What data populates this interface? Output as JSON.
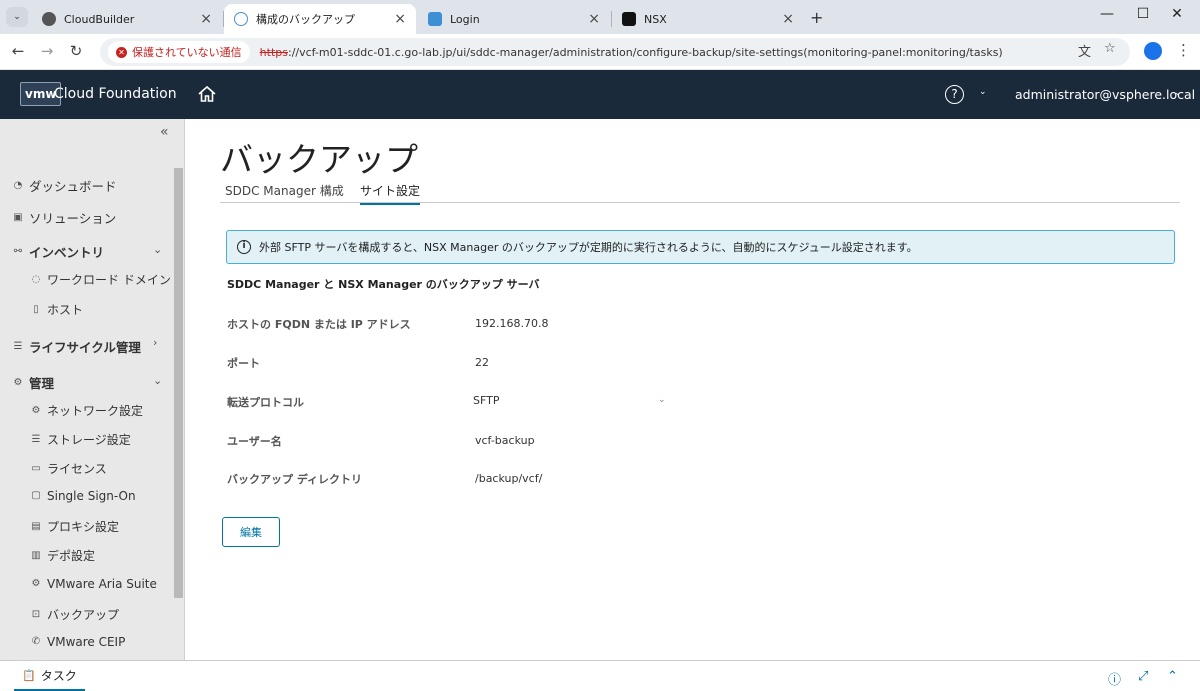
{
  "browser": {
    "tabs": [
      {
        "title": "CloudBuilder",
        "icon": "globe-icon"
      },
      {
        "title": "構成のバックアップ",
        "icon": "cloud-icon",
        "active": true
      },
      {
        "title": "Login",
        "icon": "app-icon"
      },
      {
        "title": "NSX",
        "icon": "nsx-icon"
      }
    ],
    "security_chip": "保護されていない通信",
    "url_scheme": "https",
    "url_rest": "://vcf-m01-sddc-01.c.go-lab.jp/ui/sddc-manager/administration/configure-backup/site-settings(monitoring-panel:monitoring/tasks)"
  },
  "header": {
    "logo": "vmw",
    "brand": "Cloud Foundation",
    "user": "administrator@vsphere.local"
  },
  "sidebar": {
    "top_items": [
      {
        "label": "ダッシュボード",
        "icon": "dashboard-icon"
      },
      {
        "label": "ソリューション",
        "icon": "solutions-icon"
      },
      {
        "label": "インベントリ",
        "icon": "inventory-icon"
      },
      {
        "label": "ライフサイクル管理",
        "icon": "lifecycle-icon"
      },
      {
        "label": "管理",
        "icon": "gear-icon"
      }
    ],
    "inventory_items": [
      {
        "label": "ワークロード ドメイン",
        "icon": "domain-icon"
      },
      {
        "label": "ホスト",
        "icon": "host-icon"
      }
    ],
    "admin_items": [
      {
        "label": "ネットワーク設定",
        "icon": "network-icon"
      },
      {
        "label": "ストレージ設定",
        "icon": "storage-icon"
      },
      {
        "label": "ライセンス",
        "icon": "license-icon"
      },
      {
        "label": "Single Sign-On",
        "icon": "sso-icon"
      },
      {
        "label": "プロキシ設定",
        "icon": "proxy-icon"
      },
      {
        "label": "デポ設定",
        "icon": "depot-icon"
      },
      {
        "label": "VMware Aria Suite",
        "icon": "aria-icon"
      },
      {
        "label": "バックアップ",
        "icon": "backup-icon"
      },
      {
        "label": "VMware CEIP",
        "icon": "phone-icon"
      }
    ]
  },
  "main": {
    "title": "バックアップ",
    "tabs": [
      "SDDC Manager 構成",
      "サイト設定"
    ],
    "alert": "外部 SFTP サーバを構成すると、NSX Manager のバックアップが定期的に実行されるように、自動的にスケジュール設定されます。",
    "section_title": "SDDC Manager と NSX Manager のバックアップ サーバ",
    "fields": [
      {
        "label": "ホストの FQDN または IP アドレス",
        "value": "192.168.70.8"
      },
      {
        "label": "ポート",
        "value": "22"
      },
      {
        "label": "転送プロトコル",
        "value": "SFTP"
      },
      {
        "label": "ユーザー名",
        "value": "vcf-backup"
      },
      {
        "label": "バックアップ ディレクトリ",
        "value": "/backup/vcf/"
      }
    ],
    "edit_label": "編集"
  },
  "taskbar": {
    "label": "タスク"
  }
}
